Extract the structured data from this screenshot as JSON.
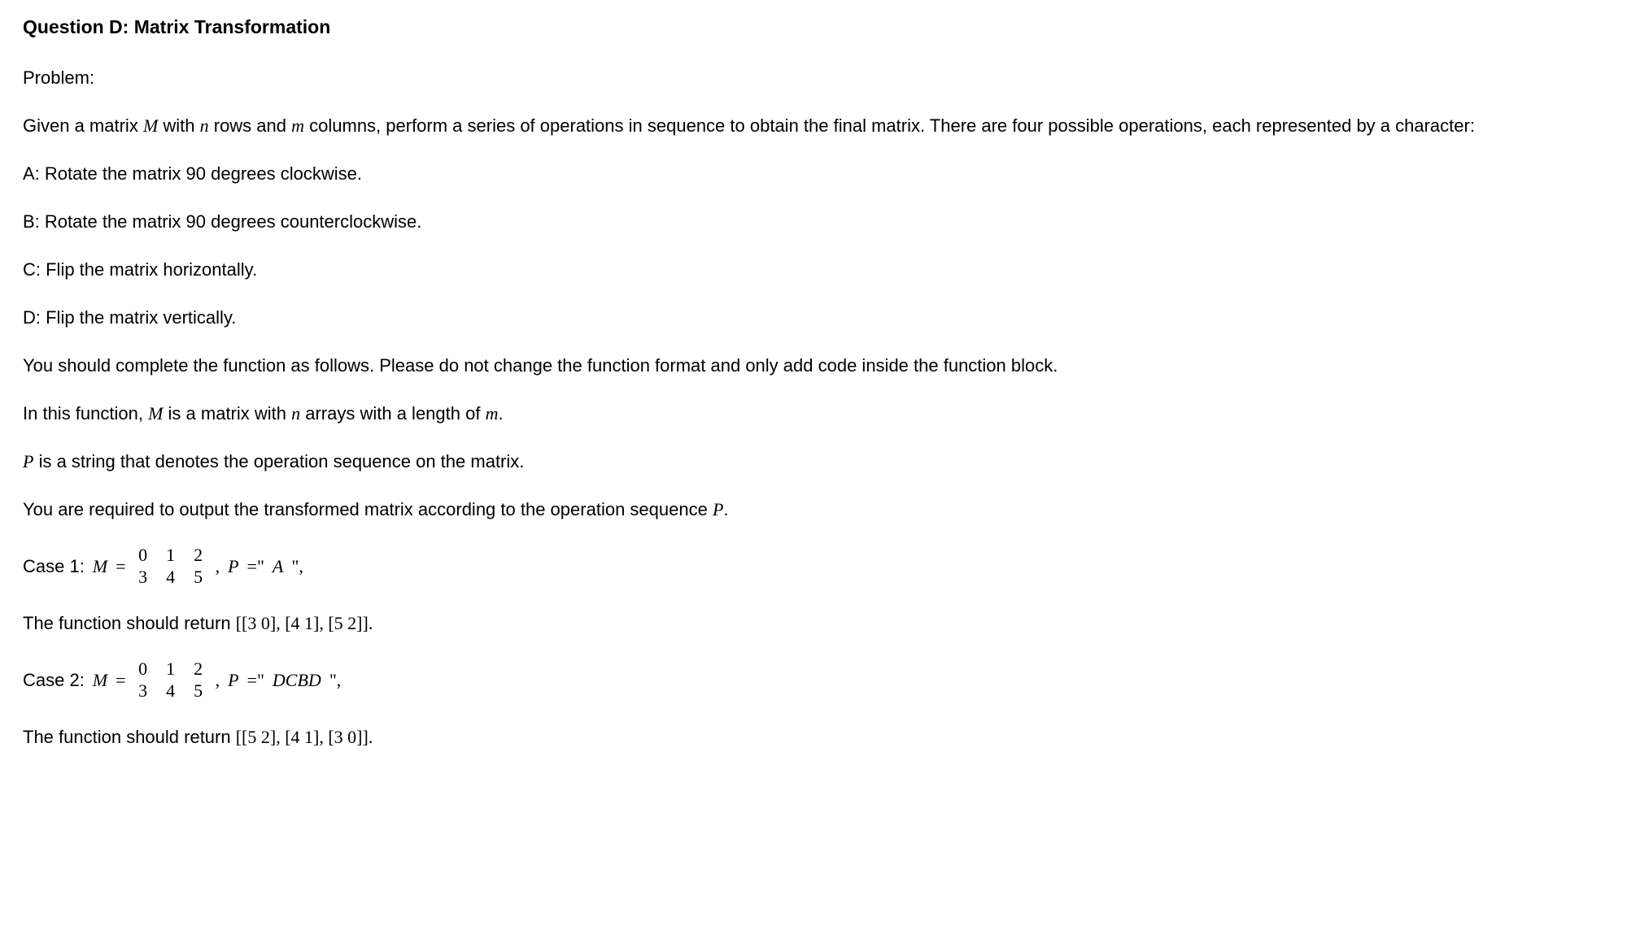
{
  "title": "Question D: Matrix Transformation",
  "problem_label": "Problem:",
  "intro_1a": "Given a matrix ",
  "intro_1b": " with ",
  "intro_1c": " rows and ",
  "intro_1d": " columns, perform a series of operations in sequence to obtain the final matrix. There are four possible operations, each represented by a character:",
  "op_a": "A: Rotate the matrix 90 degrees clockwise.",
  "op_b": "B: Rotate the matrix 90 degrees counterclockwise.",
  "op_c": "C: Flip the matrix horizontally.",
  "op_d": "D: Flip the matrix vertically.",
  "instr_1": "You should complete the function as follows. Please do not change the function format and only add code inside the function block.",
  "instr_2a": "In this function, ",
  "instr_2b": " is a matrix with ",
  "instr_2c": " arrays with a length of ",
  "instr_2d": ".",
  "instr_3a": " is a string that denotes the operation sequence on the matrix.",
  "instr_4a": "You are required to output the transformed matrix according to the operation sequence ",
  "instr_4b": ".",
  "math": {
    "M": "M",
    "n": "n",
    "m": "m",
    "P": "P",
    "eq": "=",
    "A": "A",
    "DCBD": "DCBD"
  },
  "case1": {
    "label": "Case 1: ",
    "matrix_row1": [
      "0",
      "1",
      "2"
    ],
    "matrix_row2": [
      "3",
      "4",
      "5"
    ],
    "p_prefix": ", ",
    "p_eq": " =\" ",
    "p_suffix": " \",",
    "return_text": "The function should return ",
    "return_value": "[[3 0], [4 1], [5 2]]."
  },
  "case2": {
    "label": "Case 2: ",
    "matrix_row1": [
      "0",
      "1",
      "2"
    ],
    "matrix_row2": [
      "3",
      "4",
      "5"
    ],
    "p_prefix": ", ",
    "p_eq": " =\" ",
    "p_suffix": " \",",
    "return_text": "The function should return ",
    "return_value": "[[5 2], [4 1], [3 0]]."
  }
}
